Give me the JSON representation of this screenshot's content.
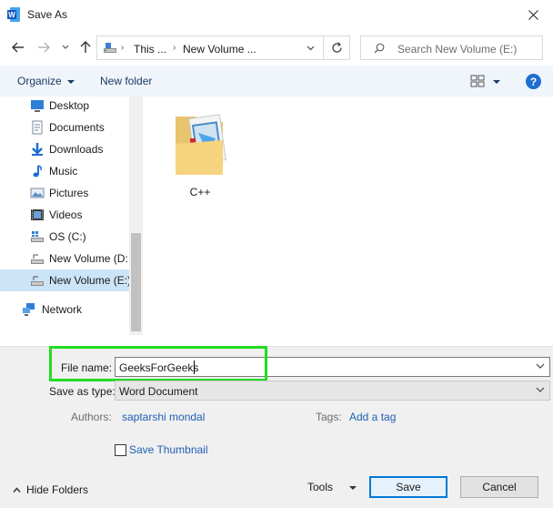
{
  "window": {
    "title": "Save As",
    "app_icon": "word-icon"
  },
  "address": {
    "crumbs": [
      "This ...",
      "New Volume ..."
    ],
    "search_placeholder": "Search New Volume (E:)"
  },
  "toolbar": {
    "organize": "Organize",
    "new_folder": "New folder",
    "help": "?"
  },
  "nav": {
    "items": [
      {
        "label": "Desktop",
        "icon": "desktop-icon"
      },
      {
        "label": "Documents",
        "icon": "documents-icon"
      },
      {
        "label": "Downloads",
        "icon": "downloads-icon"
      },
      {
        "label": "Music",
        "icon": "music-icon"
      },
      {
        "label": "Pictures",
        "icon": "pictures-icon"
      },
      {
        "label": "Videos",
        "icon": "videos-icon"
      },
      {
        "label": "OS (C:)",
        "icon": "drive-icon"
      },
      {
        "label": "New Volume (D:",
        "icon": "drive-icon"
      },
      {
        "label": "New Volume (E:)",
        "icon": "drive-icon",
        "selected": true
      },
      {
        "label": "Network",
        "icon": "network-icon"
      }
    ]
  },
  "content": {
    "items": [
      {
        "name": "C++",
        "type": "folder"
      }
    ]
  },
  "form": {
    "file_name_label": "File name:",
    "file_name_value": "GeeksForGeeks",
    "save_type_label": "Save as type:",
    "save_type_value": "Word Document",
    "authors_label": "Authors:",
    "authors_value": "saptarshi mondal",
    "tags_label": "Tags:",
    "tags_value": "Add a tag",
    "save_thumbnail_label": "Save Thumbnail",
    "save_thumbnail_checked": false
  },
  "footer": {
    "hide_folders": "Hide Folders",
    "tools": "Tools",
    "save": "Save",
    "cancel": "Cancel"
  },
  "colors": {
    "highlight": "#22dd22",
    "accent": "#0078d7",
    "link": "#1f5fb4",
    "selected": "#cce4f7"
  }
}
